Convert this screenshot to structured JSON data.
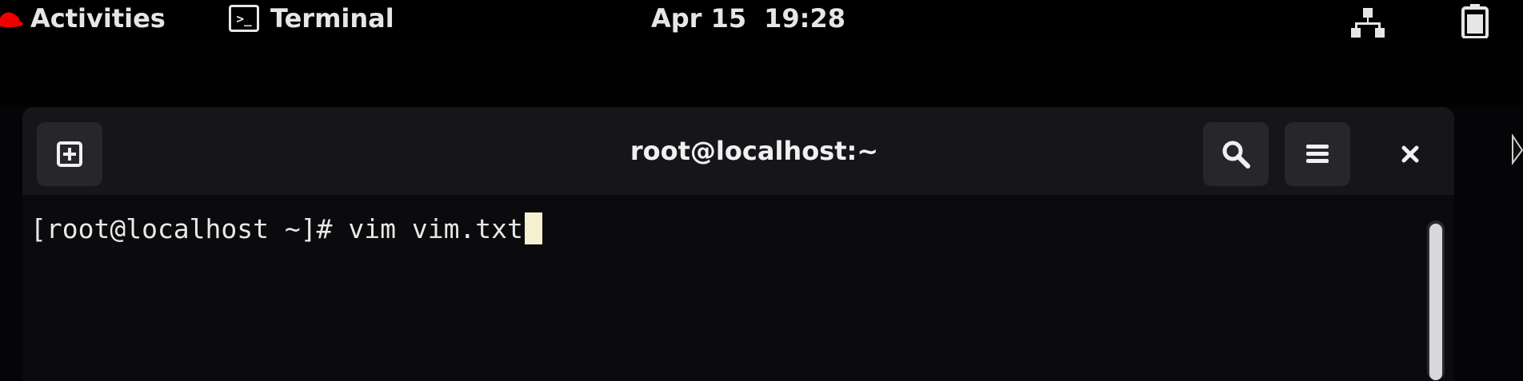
{
  "topbar": {
    "activities_label": "Activities",
    "app_name": "Terminal",
    "date": "Apr 15",
    "time": "19:28",
    "icons": [
      "redhat-logo-icon",
      "terminal-app-icon",
      "network-icon",
      "battery-icon"
    ]
  },
  "window": {
    "title": "root@localhost:~",
    "icons": [
      "new-tab-icon",
      "search-icon",
      "hamburger-menu-icon",
      "close-icon"
    ]
  },
  "terminal": {
    "prompt": "[root@localhost ~]# ",
    "command": "vim vim.txt"
  },
  "colors": {
    "topbar_bg": "#000000",
    "headerbar_bg": "#16161a",
    "button_bg": "#26262b",
    "terminal_bg": "#0b0b0e",
    "text": "#e8e8e8",
    "cursor": "#f5f0d0",
    "redhat_red": "#ee0000"
  }
}
